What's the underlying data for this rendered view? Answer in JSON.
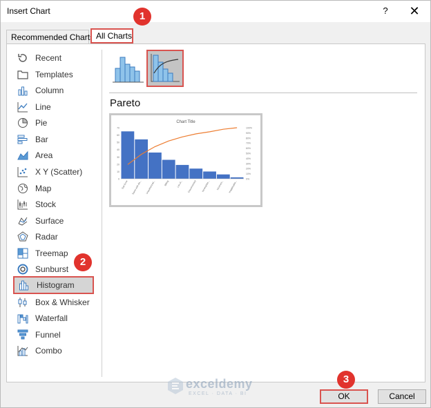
{
  "window": {
    "title": "Insert Chart",
    "help": "?",
    "close": "✕"
  },
  "tabs": [
    {
      "label": "Recommended Charts"
    },
    {
      "label": "All Charts"
    }
  ],
  "sidebar": {
    "items": [
      {
        "label": "Recent",
        "icon": "recent-icon"
      },
      {
        "label": "Templates",
        "icon": "templates-icon"
      },
      {
        "label": "Column",
        "icon": "column-chart-icon"
      },
      {
        "label": "Line",
        "icon": "line-chart-icon"
      },
      {
        "label": "Pie",
        "icon": "pie-chart-icon"
      },
      {
        "label": "Bar",
        "icon": "bar-chart-icon"
      },
      {
        "label": "Area",
        "icon": "area-chart-icon"
      },
      {
        "label": "X Y (Scatter)",
        "icon": "scatter-chart-icon"
      },
      {
        "label": "Map",
        "icon": "map-chart-icon"
      },
      {
        "label": "Stock",
        "icon": "stock-chart-icon"
      },
      {
        "label": "Surface",
        "icon": "surface-chart-icon"
      },
      {
        "label": "Radar",
        "icon": "radar-chart-icon"
      },
      {
        "label": "Treemap",
        "icon": "treemap-chart-icon"
      },
      {
        "label": "Sunburst",
        "icon": "sunburst-chart-icon"
      },
      {
        "label": "Histogram",
        "icon": "histogram-chart-icon",
        "selected": true
      },
      {
        "label": "Box & Whisker",
        "icon": "box-whisker-chart-icon"
      },
      {
        "label": "Waterfall",
        "icon": "waterfall-chart-icon"
      },
      {
        "label": "Funnel",
        "icon": "funnel-chart-icon"
      },
      {
        "label": "Combo",
        "icon": "combo-chart-icon"
      }
    ]
  },
  "subtypes": {
    "selected_name": "Pareto",
    "items": [
      {
        "icon": "histogram-subtype-icon"
      },
      {
        "icon": "pareto-subtype-icon",
        "selected": true
      }
    ]
  },
  "preview": {
    "title": "Chart Title",
    "y_ticks": [
      "70",
      "60",
      "50",
      "40",
      "30",
      "20",
      "10",
      "0"
    ],
    "y2_ticks": [
      "100%",
      "90%",
      "80%",
      "70%",
      "60%",
      "50%",
      "40%",
      "30%",
      "20%",
      "10%",
      "0%"
    ],
    "x_labels": [
      "Sub Error",
      "Same with dis...",
      "Unauthorized...",
      "Billing",
      "List of...",
      "Disconnected",
      "Incomplete...",
      "Incorrect...",
      "Inapplicable..."
    ],
    "bar_values": [
      65,
      54,
      36,
      26,
      19,
      14,
      10,
      6,
      2
    ],
    "cumulative_pct": [
      28,
      48,
      63,
      74,
      82,
      88,
      92,
      97,
      100
    ],
    "colors": {
      "bar": "#4472c4",
      "line": "#ed7d31"
    }
  },
  "buttons": {
    "ok": "OK",
    "cancel": "Cancel"
  },
  "annotations": [
    "1",
    "2",
    "3"
  ],
  "watermark": {
    "name": "exceldemy",
    "tagline": "EXCEL · DATA · BI"
  }
}
